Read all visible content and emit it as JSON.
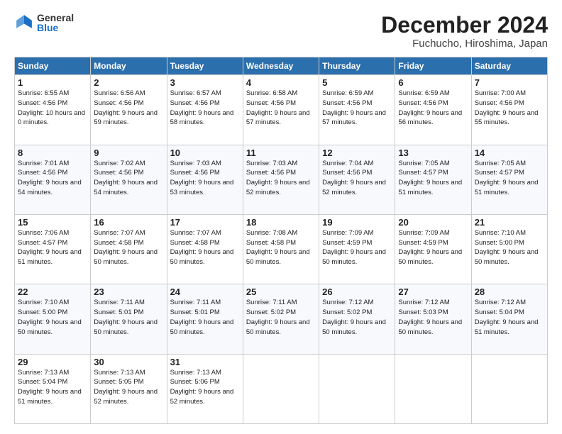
{
  "header": {
    "logo_general": "General",
    "logo_blue": "Blue",
    "month_title": "December 2024",
    "location": "Fuchucho, Hiroshima, Japan"
  },
  "weekdays": [
    "Sunday",
    "Monday",
    "Tuesday",
    "Wednesday",
    "Thursday",
    "Friday",
    "Saturday"
  ],
  "weeks": [
    [
      {
        "day": "1",
        "sunrise": "6:55 AM",
        "sunset": "4:56 PM",
        "daylight": "10 hours and 0 minutes."
      },
      {
        "day": "2",
        "sunrise": "6:56 AM",
        "sunset": "4:56 PM",
        "daylight": "9 hours and 59 minutes."
      },
      {
        "day": "3",
        "sunrise": "6:57 AM",
        "sunset": "4:56 PM",
        "daylight": "9 hours and 58 minutes."
      },
      {
        "day": "4",
        "sunrise": "6:58 AM",
        "sunset": "4:56 PM",
        "daylight": "9 hours and 57 minutes."
      },
      {
        "day": "5",
        "sunrise": "6:59 AM",
        "sunset": "4:56 PM",
        "daylight": "9 hours and 57 minutes."
      },
      {
        "day": "6",
        "sunrise": "6:59 AM",
        "sunset": "4:56 PM",
        "daylight": "9 hours and 56 minutes."
      },
      {
        "day": "7",
        "sunrise": "7:00 AM",
        "sunset": "4:56 PM",
        "daylight": "9 hours and 55 minutes."
      }
    ],
    [
      {
        "day": "8",
        "sunrise": "7:01 AM",
        "sunset": "4:56 PM",
        "daylight": "9 hours and 54 minutes."
      },
      {
        "day": "9",
        "sunrise": "7:02 AM",
        "sunset": "4:56 PM",
        "daylight": "9 hours and 54 minutes."
      },
      {
        "day": "10",
        "sunrise": "7:03 AM",
        "sunset": "4:56 PM",
        "daylight": "9 hours and 53 minutes."
      },
      {
        "day": "11",
        "sunrise": "7:03 AM",
        "sunset": "4:56 PM",
        "daylight": "9 hours and 52 minutes."
      },
      {
        "day": "12",
        "sunrise": "7:04 AM",
        "sunset": "4:56 PM",
        "daylight": "9 hours and 52 minutes."
      },
      {
        "day": "13",
        "sunrise": "7:05 AM",
        "sunset": "4:57 PM",
        "daylight": "9 hours and 51 minutes."
      },
      {
        "day": "14",
        "sunrise": "7:05 AM",
        "sunset": "4:57 PM",
        "daylight": "9 hours and 51 minutes."
      }
    ],
    [
      {
        "day": "15",
        "sunrise": "7:06 AM",
        "sunset": "4:57 PM",
        "daylight": "9 hours and 51 minutes."
      },
      {
        "day": "16",
        "sunrise": "7:07 AM",
        "sunset": "4:58 PM",
        "daylight": "9 hours and 50 minutes."
      },
      {
        "day": "17",
        "sunrise": "7:07 AM",
        "sunset": "4:58 PM",
        "daylight": "9 hours and 50 minutes."
      },
      {
        "day": "18",
        "sunrise": "7:08 AM",
        "sunset": "4:58 PM",
        "daylight": "9 hours and 50 minutes."
      },
      {
        "day": "19",
        "sunrise": "7:09 AM",
        "sunset": "4:59 PM",
        "daylight": "9 hours and 50 minutes."
      },
      {
        "day": "20",
        "sunrise": "7:09 AM",
        "sunset": "4:59 PM",
        "daylight": "9 hours and 50 minutes."
      },
      {
        "day": "21",
        "sunrise": "7:10 AM",
        "sunset": "5:00 PM",
        "daylight": "9 hours and 50 minutes."
      }
    ],
    [
      {
        "day": "22",
        "sunrise": "7:10 AM",
        "sunset": "5:00 PM",
        "daylight": "9 hours and 50 minutes."
      },
      {
        "day": "23",
        "sunrise": "7:11 AM",
        "sunset": "5:01 PM",
        "daylight": "9 hours and 50 minutes."
      },
      {
        "day": "24",
        "sunrise": "7:11 AM",
        "sunset": "5:01 PM",
        "daylight": "9 hours and 50 minutes."
      },
      {
        "day": "25",
        "sunrise": "7:11 AM",
        "sunset": "5:02 PM",
        "daylight": "9 hours and 50 minutes."
      },
      {
        "day": "26",
        "sunrise": "7:12 AM",
        "sunset": "5:02 PM",
        "daylight": "9 hours and 50 minutes."
      },
      {
        "day": "27",
        "sunrise": "7:12 AM",
        "sunset": "5:03 PM",
        "daylight": "9 hours and 50 minutes."
      },
      {
        "day": "28",
        "sunrise": "7:12 AM",
        "sunset": "5:04 PM",
        "daylight": "9 hours and 51 minutes."
      }
    ],
    [
      {
        "day": "29",
        "sunrise": "7:13 AM",
        "sunset": "5:04 PM",
        "daylight": "9 hours and 51 minutes."
      },
      {
        "day": "30",
        "sunrise": "7:13 AM",
        "sunset": "5:05 PM",
        "daylight": "9 hours and 52 minutes."
      },
      {
        "day": "31",
        "sunrise": "7:13 AM",
        "sunset": "5:06 PM",
        "daylight": "9 hours and 52 minutes."
      },
      null,
      null,
      null,
      null
    ]
  ],
  "labels": {
    "sunrise": "Sunrise:",
    "sunset": "Sunset:",
    "daylight": "Daylight:"
  }
}
